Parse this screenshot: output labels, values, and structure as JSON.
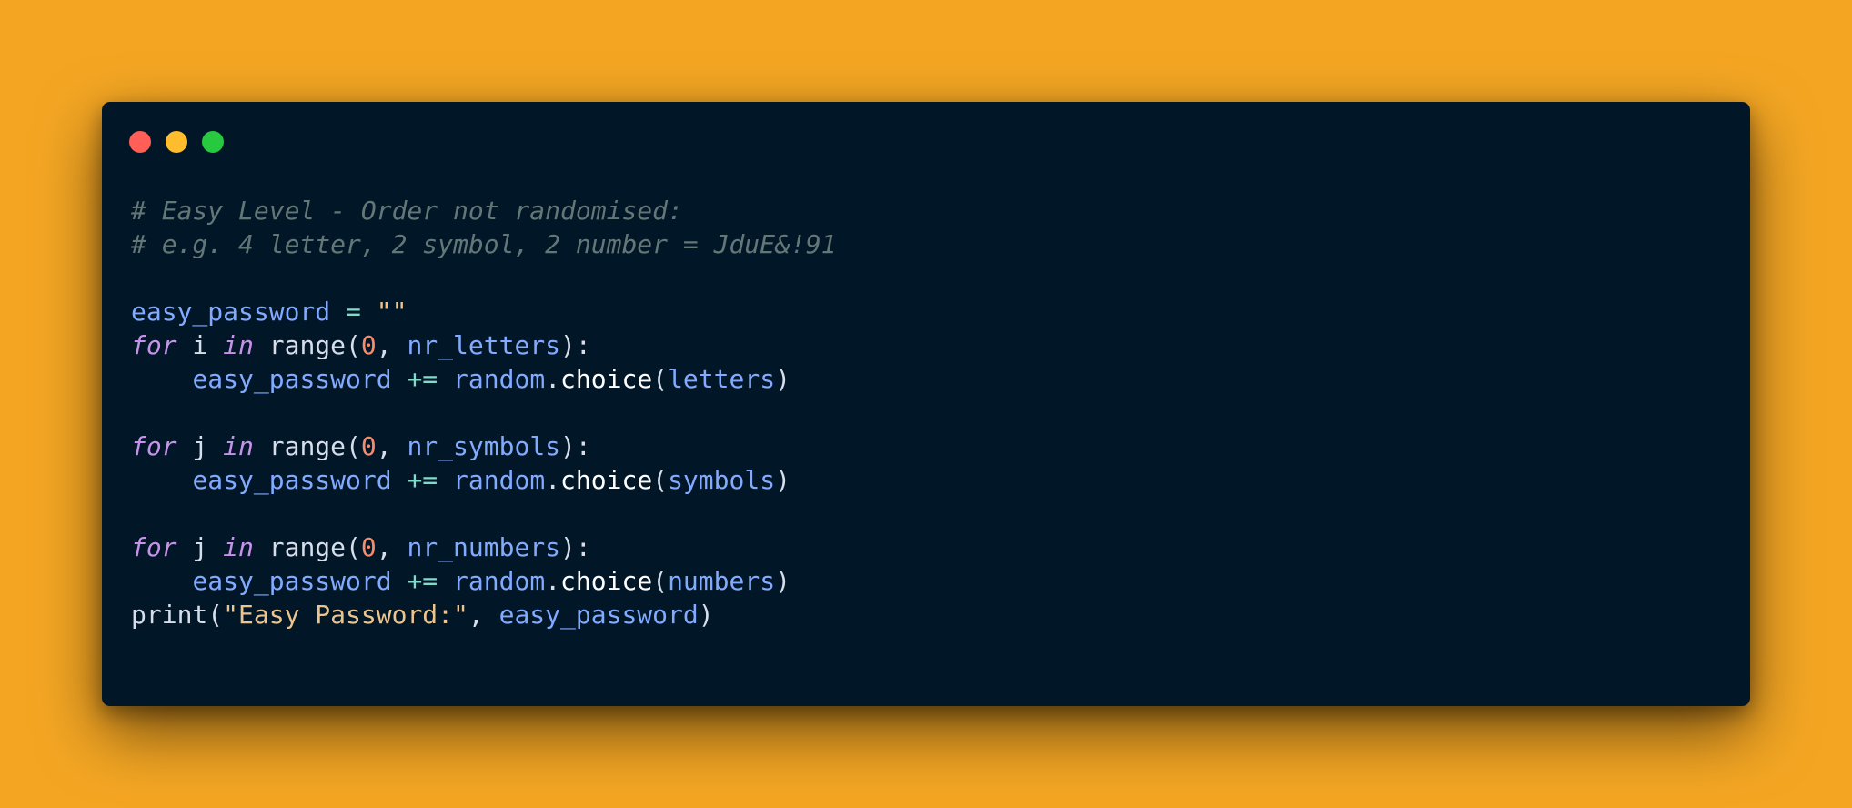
{
  "theme": {
    "background": "#F4A623",
    "window_bg": "#011627",
    "dot_close": "#FF5F56",
    "dot_minimize": "#FFBD2E",
    "dot_maximize": "#27C93F"
  },
  "window": {
    "controls": [
      "close-dot",
      "minimize-dot",
      "maximize-dot"
    ]
  },
  "code": {
    "language": "python",
    "lines": [
      [
        {
          "t": "# Easy Level - Order not randomised:",
          "k": "comment"
        }
      ],
      [
        {
          "t": "# e.g. 4 letter, 2 symbol, 2 number = JduE&!91",
          "k": "comment"
        }
      ],
      [],
      [
        {
          "t": "easy_password",
          "k": "variable"
        },
        {
          "t": " ",
          "k": "plain"
        },
        {
          "t": "=",
          "k": "operator"
        },
        {
          "t": " ",
          "k": "plain"
        },
        {
          "t": "\"\"",
          "k": "string"
        }
      ],
      [
        {
          "t": "for",
          "k": "keyword"
        },
        {
          "t": " i ",
          "k": "plain"
        },
        {
          "t": "in",
          "k": "keyword"
        },
        {
          "t": " ",
          "k": "plain"
        },
        {
          "t": "range",
          "k": "builtin"
        },
        {
          "t": "(",
          "k": "punct"
        },
        {
          "t": "0",
          "k": "number"
        },
        {
          "t": ", ",
          "k": "punct"
        },
        {
          "t": "nr_letters",
          "k": "variable"
        },
        {
          "t": "):",
          "k": "punct"
        }
      ],
      [
        {
          "t": "    ",
          "k": "plain"
        },
        {
          "t": "easy_password",
          "k": "variable"
        },
        {
          "t": " ",
          "k": "plain"
        },
        {
          "t": "+=",
          "k": "operator"
        },
        {
          "t": " ",
          "k": "plain"
        },
        {
          "t": "random",
          "k": "variable"
        },
        {
          "t": ".",
          "k": "punct"
        },
        {
          "t": "choice",
          "k": "method"
        },
        {
          "t": "(",
          "k": "punct"
        },
        {
          "t": "letters",
          "k": "variable"
        },
        {
          "t": ")",
          "k": "punct"
        }
      ],
      [],
      [
        {
          "t": "for",
          "k": "keyword"
        },
        {
          "t": " j ",
          "k": "plain"
        },
        {
          "t": "in",
          "k": "keyword"
        },
        {
          "t": " ",
          "k": "plain"
        },
        {
          "t": "range",
          "k": "builtin"
        },
        {
          "t": "(",
          "k": "punct"
        },
        {
          "t": "0",
          "k": "number"
        },
        {
          "t": ", ",
          "k": "punct"
        },
        {
          "t": "nr_symbols",
          "k": "variable"
        },
        {
          "t": "):",
          "k": "punct"
        }
      ],
      [
        {
          "t": "    ",
          "k": "plain"
        },
        {
          "t": "easy_password",
          "k": "variable"
        },
        {
          "t": " ",
          "k": "plain"
        },
        {
          "t": "+=",
          "k": "operator"
        },
        {
          "t": " ",
          "k": "plain"
        },
        {
          "t": "random",
          "k": "variable"
        },
        {
          "t": ".",
          "k": "punct"
        },
        {
          "t": "choice",
          "k": "method"
        },
        {
          "t": "(",
          "k": "punct"
        },
        {
          "t": "symbols",
          "k": "variable"
        },
        {
          "t": ")",
          "k": "punct"
        }
      ],
      [],
      [
        {
          "t": "for",
          "k": "keyword"
        },
        {
          "t": " j ",
          "k": "plain"
        },
        {
          "t": "in",
          "k": "keyword"
        },
        {
          "t": " ",
          "k": "plain"
        },
        {
          "t": "range",
          "k": "builtin"
        },
        {
          "t": "(",
          "k": "punct"
        },
        {
          "t": "0",
          "k": "number"
        },
        {
          "t": ", ",
          "k": "punct"
        },
        {
          "t": "nr_numbers",
          "k": "variable"
        },
        {
          "t": "):",
          "k": "punct"
        }
      ],
      [
        {
          "t": "    ",
          "k": "plain"
        },
        {
          "t": "easy_password",
          "k": "variable"
        },
        {
          "t": " ",
          "k": "plain"
        },
        {
          "t": "+=",
          "k": "operator"
        },
        {
          "t": " ",
          "k": "plain"
        },
        {
          "t": "random",
          "k": "variable"
        },
        {
          "t": ".",
          "k": "punct"
        },
        {
          "t": "choice",
          "k": "method"
        },
        {
          "t": "(",
          "k": "punct"
        },
        {
          "t": "numbers",
          "k": "variable"
        },
        {
          "t": ")",
          "k": "punct"
        }
      ],
      [
        {
          "t": "print",
          "k": "builtin"
        },
        {
          "t": "(",
          "k": "punct"
        },
        {
          "t": "\"Easy Password:\"",
          "k": "string"
        },
        {
          "t": ", ",
          "k": "punct"
        },
        {
          "t": "easy_password",
          "k": "variable"
        },
        {
          "t": ")",
          "k": "punct"
        }
      ]
    ]
  },
  "syntax_colors": {
    "comment": "#637777",
    "keyword": "#C792EA",
    "variable": "#82AAFF",
    "operator": "#7FDBCA",
    "string": "#ECC48D",
    "number": "#F78C6C",
    "builtin": "#D6DEEB",
    "method": "#FFFFFF",
    "punct": "#D6DEEB",
    "plain": "#D6DEEB"
  }
}
